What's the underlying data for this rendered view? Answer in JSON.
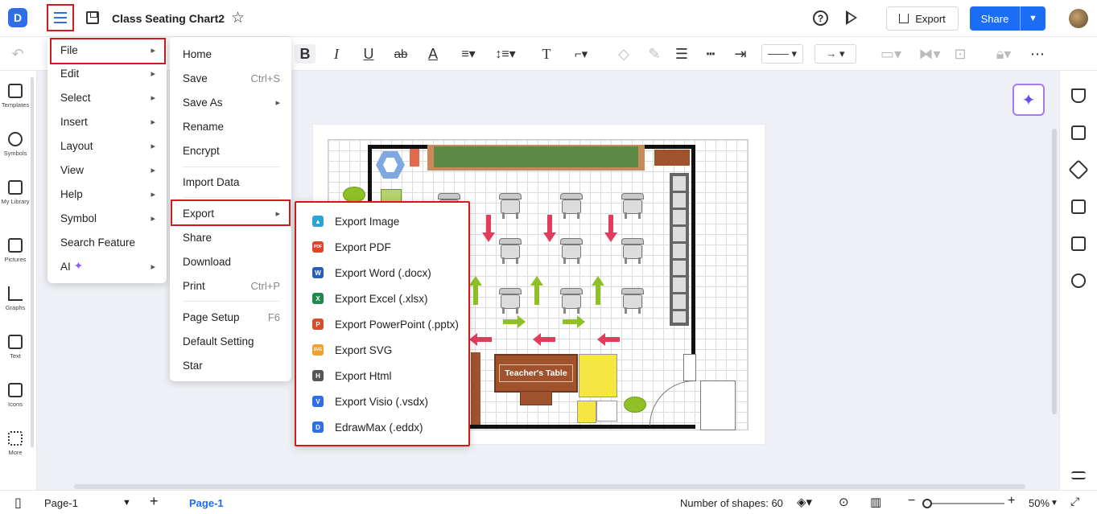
{
  "header": {
    "logo_icon": "edrawmax-logo-icon",
    "doc_title": "Class Seating Chart2",
    "export_label": "Export",
    "share_label": "Share",
    "brand_color": "#1b6ef3",
    "highlight_color": "#d11a1a"
  },
  "left_sidebar": {
    "items": [
      {
        "label": "Templates",
        "icon": "templates-icon"
      },
      {
        "label": "Symbols",
        "icon": "symbols-icon"
      },
      {
        "label": "My Library",
        "icon": "library-icon"
      },
      {
        "label": "Pictures",
        "icon": "pictures-icon"
      },
      {
        "label": "Graphs",
        "icon": "graphs-icon"
      },
      {
        "label": "Text",
        "icon": "text-icon"
      },
      {
        "label": "Icons",
        "icon": "icons-icon"
      },
      {
        "label": "More",
        "icon": "more-grid-icon"
      }
    ]
  },
  "main_menu": {
    "items": [
      {
        "label": "File"
      },
      {
        "label": "Edit"
      },
      {
        "label": "Select"
      },
      {
        "label": "Insert"
      },
      {
        "label": "Layout"
      },
      {
        "label": "View"
      },
      {
        "label": "Help"
      },
      {
        "label": "Symbol"
      },
      {
        "label": "Search Feature"
      },
      {
        "label": "AI"
      }
    ]
  },
  "file_menu": {
    "items": [
      {
        "label": "Home",
        "shortcut": ""
      },
      {
        "label": "Save",
        "shortcut": "Ctrl+S"
      },
      {
        "label": "Save As",
        "shortcut": ""
      },
      {
        "label": "Rename",
        "shortcut": ""
      },
      {
        "label": "Encrypt",
        "shortcut": ""
      },
      {
        "label": "Import Data",
        "shortcut": ""
      },
      {
        "label": "Export",
        "shortcut": ""
      },
      {
        "label": "Share",
        "shortcut": ""
      },
      {
        "label": "Download",
        "shortcut": ""
      },
      {
        "label": "Print",
        "shortcut": "Ctrl+P"
      },
      {
        "label": "Page Setup",
        "shortcut": "F6"
      },
      {
        "label": "Default Setting",
        "shortcut": ""
      },
      {
        "label": "Star",
        "shortcut": ""
      }
    ]
  },
  "export_menu": {
    "items": [
      {
        "label": "Export Image",
        "badge": "",
        "color": "#2ea3d8"
      },
      {
        "label": "Export PDF",
        "badge": "PDF",
        "color": "#e0452b"
      },
      {
        "label": "Export Word (.docx)",
        "badge": "W",
        "color": "#2b5cb8"
      },
      {
        "label": "Export Excel (.xlsx)",
        "badge": "X",
        "color": "#1f8a4c"
      },
      {
        "label": "Export PowerPoint (.pptx)",
        "badge": "P",
        "color": "#d2502c"
      },
      {
        "label": "Export SVG",
        "badge": "SVG",
        "color": "#f0a030"
      },
      {
        "label": "Export Html",
        "badge": "H",
        "color": "#555555"
      },
      {
        "label": "Export Visio (.vsdx)",
        "badge": "V",
        "color": "#2f6ee8"
      },
      {
        "label": "EdrawMax (.eddx)",
        "badge": "D",
        "color": "#2f6ee8"
      }
    ]
  },
  "canvas": {
    "teacher_table_label": "Teacher's Table"
  },
  "statusbar": {
    "page_select": "Page-1",
    "page_tab": "Page-1",
    "shape_count": "Number of shapes: 60",
    "zoom": "50%"
  }
}
